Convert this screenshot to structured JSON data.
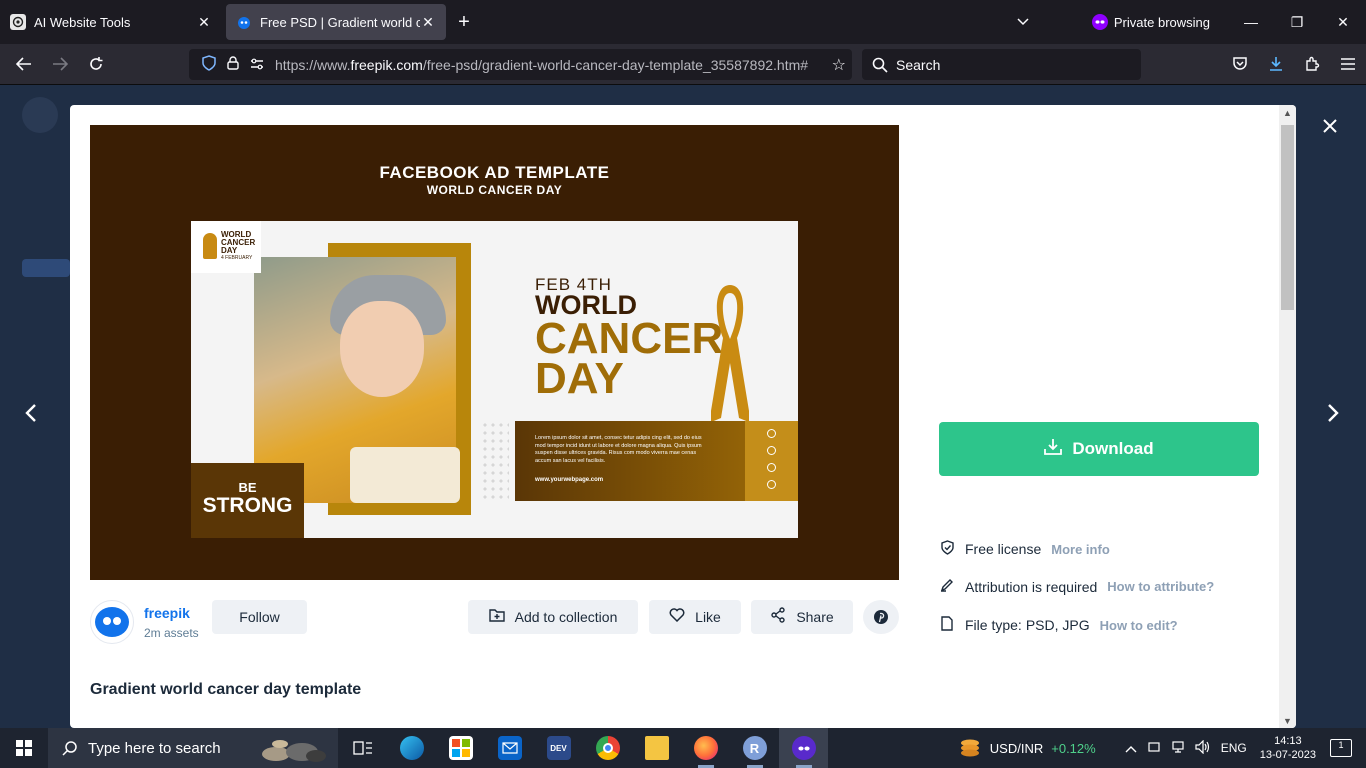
{
  "browser": {
    "tabs": [
      {
        "title": "AI Website Tools",
        "active": false
      },
      {
        "title": "Free PSD | Gradient world cance",
        "active": true
      }
    ],
    "private_label": "Private browsing",
    "url_prefix": "https://www.",
    "url_domain": "freepik.com",
    "url_path": "/free-psd/gradient-world-cancer-day-template_35587892.htm#",
    "search_placeholder": "Search"
  },
  "preview": {
    "heading1": "FACEBOOK AD TEMPLATE",
    "heading2": "WORLD CANCER DAY",
    "logo_text": "WORLD CANCER DAY",
    "logo_sub": "4 FEBRUARY",
    "be": "BE",
    "strong": "STRONG",
    "feb": "FEB 4TH",
    "world": "WORLD",
    "cancer": "CANCER",
    "day": "DAY",
    "lorem": "Lorem ipsum dolor sit amet, consec tetur adipis cing elit, sed do eius mod tempor incid idunt ut labore et dolore magna aliqua. Quis ipsum suspen disse ultrices gravida. Risus com modo viverra mae cenas accum san lacus vel facilisis.",
    "website": "www.yourwebpage.com"
  },
  "author": {
    "name": "freepik",
    "assets": "2m assets",
    "follow_label": "Follow"
  },
  "actions": {
    "collection_label": "Add to collection",
    "like_label": "Like",
    "share_label": "Share"
  },
  "asset": {
    "title": "Gradient world cancer day template"
  },
  "sidebar": {
    "download_label": "Download",
    "license_label": "Free license",
    "license_link": "More info",
    "attribution_label": "Attribution is required",
    "attribution_link": "How to attribute?",
    "filetype_label": "File type:",
    "filetype_value": "PSD, JPG",
    "filetype_link": "How to edit?"
  },
  "taskbar": {
    "search_placeholder": "Type here to search",
    "stock_label": "USD/INR",
    "stock_change": "+0.12%",
    "language": "ENG",
    "time": "14:13",
    "date": "13-07-2023",
    "notification_count": "1"
  },
  "colors": {
    "download": "#2dc58b",
    "brand_blue": "#1273eb",
    "preview_bg": "#3a1e04",
    "gold": "#a06d07"
  }
}
